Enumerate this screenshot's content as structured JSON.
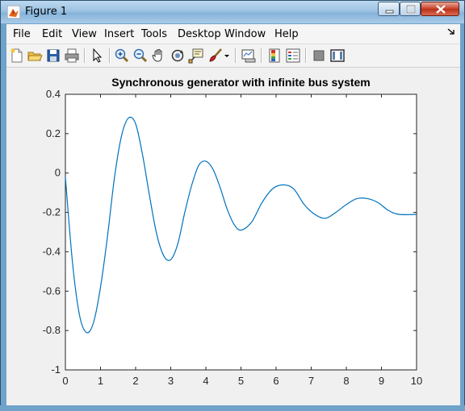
{
  "window": {
    "title": "Figure 1"
  },
  "menu": [
    "File",
    "Edit",
    "View",
    "Insert",
    "Tools",
    "Desktop",
    "Window",
    "Help"
  ],
  "toolbar": [
    {
      "icon": "new-figure-icon"
    },
    {
      "icon": "open-file-icon"
    },
    {
      "icon": "save-icon"
    },
    {
      "icon": "print-icon"
    },
    {
      "icon": "edit-plot-arrow-icon"
    },
    {
      "icon": "zoom-in-icon"
    },
    {
      "icon": "zoom-out-icon"
    },
    {
      "icon": "pan-hand-icon"
    },
    {
      "icon": "rotate-3d-icon"
    },
    {
      "icon": "data-cursor-icon"
    },
    {
      "icon": "brush-icon"
    },
    {
      "icon": "brush-dropdown-icon"
    },
    {
      "icon": "link-plot-icon"
    },
    {
      "icon": "colorbar-icon"
    },
    {
      "icon": "legend-icon"
    },
    {
      "icon": "hide-plot-tools-icon"
    },
    {
      "icon": "show-plot-tools-icon"
    }
  ],
  "chart_data": {
    "type": "line",
    "title": "Synchronous generator with infinite bus system",
    "xlabel": "",
    "ylabel": "",
    "xlim": [
      0,
      10
    ],
    "ylim": [
      -1,
      0.4
    ],
    "xticks": [
      "0",
      "1",
      "2",
      "3",
      "4",
      "5",
      "6",
      "7",
      "8",
      "9",
      "10"
    ],
    "yticks": [
      "0.4",
      "0.2",
      "0",
      "-0.2",
      "-0.4",
      "-0.6",
      "-0.8",
      "-1"
    ],
    "grid": false,
    "series": [
      {
        "color": "#0072bd",
        "x": [
          0,
          0.2,
          0.4,
          0.6,
          0.8,
          1.0,
          1.2,
          1.4,
          1.6,
          1.8,
          2.0,
          2.2,
          2.4,
          2.6,
          2.8,
          3.0,
          3.2,
          3.4,
          3.6,
          3.8,
          4.0,
          4.2,
          4.4,
          4.6,
          4.8,
          5.0,
          5.3,
          5.6,
          5.9,
          6.2,
          6.5,
          6.8,
          7.1,
          7.4,
          7.7,
          8.0,
          8.3,
          8.6,
          8.9,
          9.2,
          9.5,
          10.0
        ],
        "y": [
          -0.02,
          -0.45,
          -0.72,
          -0.81,
          -0.76,
          -0.58,
          -0.32,
          -0.02,
          0.19,
          0.28,
          0.25,
          0.09,
          -0.12,
          -0.31,
          -0.42,
          -0.44,
          -0.36,
          -0.2,
          -0.06,
          0.04,
          0.06,
          0.02,
          -0.07,
          -0.18,
          -0.26,
          -0.29,
          -0.25,
          -0.15,
          -0.08,
          -0.06,
          -0.08,
          -0.16,
          -0.21,
          -0.23,
          -0.2,
          -0.16,
          -0.13,
          -0.13,
          -0.15,
          -0.19,
          -0.21,
          -0.21
        ]
      }
    ]
  }
}
